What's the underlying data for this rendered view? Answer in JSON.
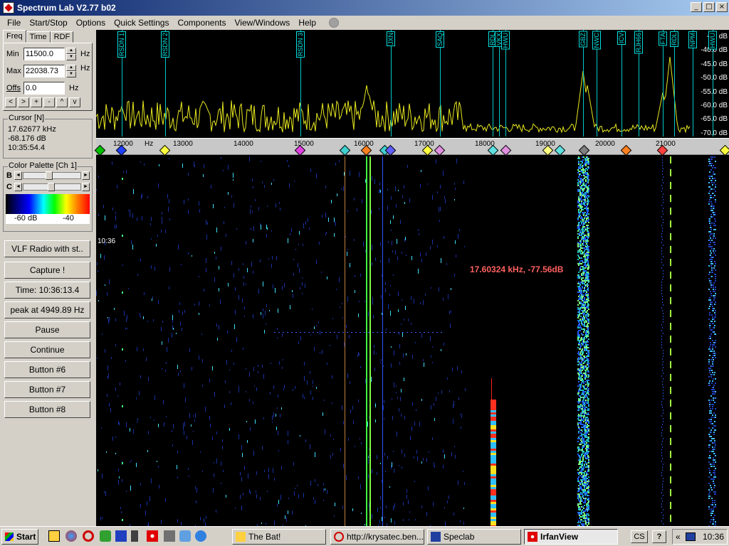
{
  "window": {
    "title": "Spectrum Lab V2.77 b02"
  },
  "menu": [
    "File",
    "Start/Stop",
    "Options",
    "Quick Settings",
    "Components",
    "View/Windows",
    "Help"
  ],
  "tabs": [
    "Freq",
    "Time",
    "RDF"
  ],
  "freq": {
    "min_label": "Min",
    "min_value": "11500.0",
    "max_label": "Max",
    "max_value": "22038.73",
    "offs_label": "Offs",
    "offs_value": "0.0",
    "unit": "Hz",
    "buttons": [
      "<",
      ">",
      "+",
      "-",
      "^",
      "v"
    ]
  },
  "cursor": {
    "title": "Cursor [N]",
    "freq": "17.62677 kHz",
    "level": "-68.176 dB",
    "time": "10:35:54.4"
  },
  "palette": {
    "title": "Color Palette [Ch 1]",
    "b_label": "B",
    "c_label": "C",
    "b_level": 0.55,
    "c_level": 0.58,
    "low": "-60 dB",
    "high": "-40"
  },
  "buttons": [
    "VLF Radio with st..",
    "Capture !",
    "Time:  10:36:13.4",
    "peak at 4949.89 Hz",
    "Pause",
    "Continue",
    "Button #6",
    "Button #7",
    "Button #8"
  ],
  "db_scale": [
    "-35 dB",
    "-40.0 dB",
    "-45.0 dB",
    "-50.0 dB",
    "-55.0 dB",
    "-60.0 dB",
    "-65.0 dB",
    "-70.0 dB"
  ],
  "axis": {
    "unit": "Hz",
    "ticks": [
      "12000",
      "13000",
      "14000",
      "15000",
      "16000",
      "17000",
      "18000",
      "19000",
      "20000",
      "21000"
    ]
  },
  "stations": [
    "RSDN 1",
    "RSDN 2",
    "RSDN 3",
    "JXN",
    "SAQ",
    "RDL",
    "VKX",
    "HWU",
    "GBZ",
    "NWC",
    "ICV",
    "RJH66",
    "FTA",
    "RDL",
    "NPM",
    "HWU"
  ],
  "waterfall": {
    "timestamp": "10:36",
    "readout": "17.60324 kHz, -77.56dB"
  },
  "taskbar": {
    "start": "Start",
    "items": [
      "The Bat!",
      "http://krysatec.ben...",
      "Speclab",
      "IrfanView"
    ],
    "tray_items": [
      "CS",
      "?"
    ],
    "clock": "10:36"
  }
}
